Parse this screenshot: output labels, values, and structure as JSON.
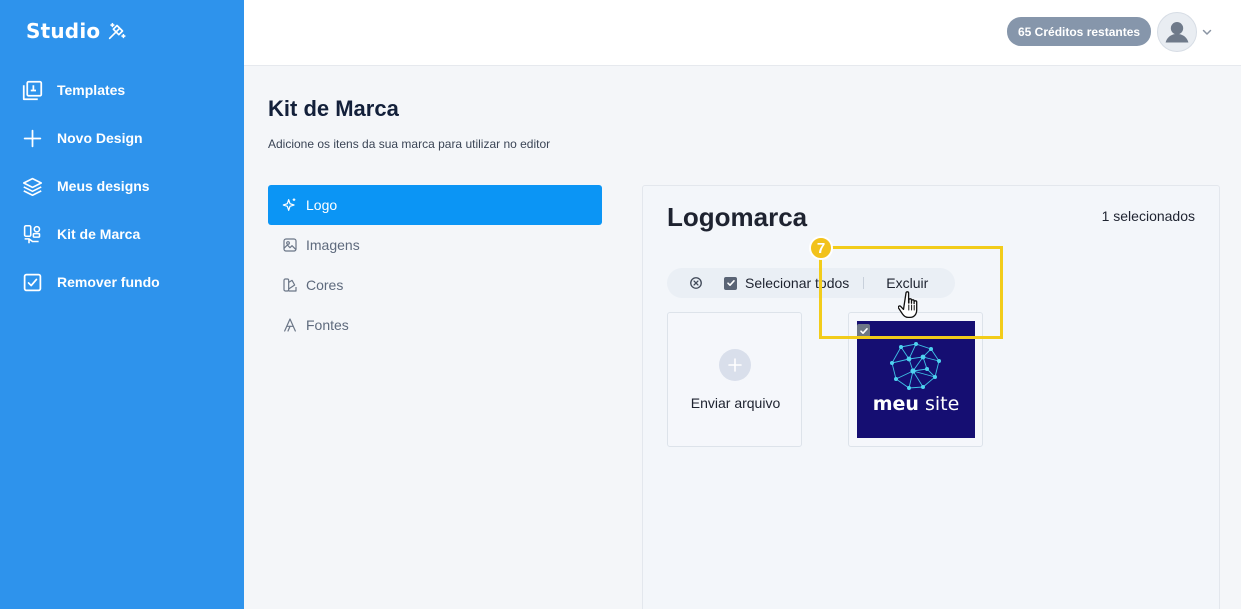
{
  "brand": {
    "name": "Studio",
    "icon": "magic-pen-icon"
  },
  "nav": [
    {
      "label": "Templates",
      "icon": "templates-icon"
    },
    {
      "label": "Novo Design",
      "icon": "plus-icon"
    },
    {
      "label": "Meus designs",
      "icon": "layers-icon"
    },
    {
      "label": "Kit de Marca",
      "icon": "brand-kit-icon"
    },
    {
      "label": "Remover fundo",
      "icon": "checkbox-icon"
    }
  ],
  "header": {
    "credits": "65 Créditos restantes",
    "avatar_icon": "user-avatar-icon"
  },
  "page": {
    "title": "Kit de Marca",
    "subtitle": "Adicione os itens da sua marca para utilizar no editor"
  },
  "menu": [
    {
      "label": "Logo",
      "icon": "sparkle-icon",
      "active": true
    },
    {
      "label": "Imagens",
      "icon": "image-icon",
      "active": false
    },
    {
      "label": "Cores",
      "icon": "palette-icon",
      "active": false
    },
    {
      "label": "Fontes",
      "icon": "font-icon",
      "active": false
    }
  ],
  "panel": {
    "title": "Logomarca",
    "selected_count": "1 selecionados",
    "toolbar": {
      "select_all": "Selecionar todos",
      "delete": "Excluir"
    },
    "upload_label": "Enviar arquivo",
    "logo": {
      "text_bold": "meu",
      "text_regular": " site",
      "selected": true
    }
  },
  "annotation": {
    "step": "7",
    "color": "#f2cc1a"
  },
  "colors": {
    "sidebar": "#2e93ec",
    "active_menu": "#0b95f5",
    "credits_badge": "#8696ab",
    "logo_bg": "#150e72"
  }
}
